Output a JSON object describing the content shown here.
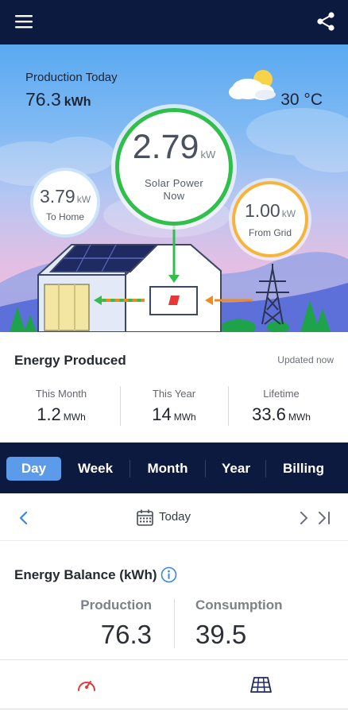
{
  "hero": {
    "production_label": "Production Today",
    "production_value": "76.3",
    "production_unit": "kWh",
    "temperature": "30 °C",
    "weather_icon": "partly-cloudy-icon",
    "solar": {
      "value": "2.79",
      "unit": "kW",
      "label_line1": "Solar Power",
      "label_line2": "Now"
    },
    "home": {
      "value": "3.79",
      "unit": "kW",
      "label": "To Home"
    },
    "grid": {
      "value": "1.00",
      "unit": "kW",
      "label": "From Grid"
    }
  },
  "energy_produced": {
    "title": "Energy Produced",
    "updated": "Updated now",
    "stats": [
      {
        "label": "This Month",
        "value": "1.2",
        "unit": "MWh"
      },
      {
        "label": "This Year",
        "value": "14",
        "unit": "MWh"
      },
      {
        "label": "Lifetime",
        "value": "33.6",
        "unit": "MWh"
      }
    ]
  },
  "tabs": [
    "Day",
    "Week",
    "Month",
    "Year",
    "Billing"
  ],
  "active_tab": "Day",
  "date_nav": {
    "label": "Today"
  },
  "energy_balance": {
    "title": "Energy Balance (kWh)",
    "production_label": "Production",
    "production_value": "76.3",
    "consumption_label": "Consumption",
    "consumption_value": "39.5"
  },
  "bottom_nav": {
    "items": [
      "dashboard-gauge-icon",
      "solar-panel-layout-icon"
    ]
  },
  "colors": {
    "navy": "#0d1a3f",
    "solar_green": "#2fbf4a",
    "grid_orange": "#f5b53c",
    "active_tab": "#5b9bea",
    "link_blue": "#3a86e0",
    "accent_red": "#e53935"
  }
}
